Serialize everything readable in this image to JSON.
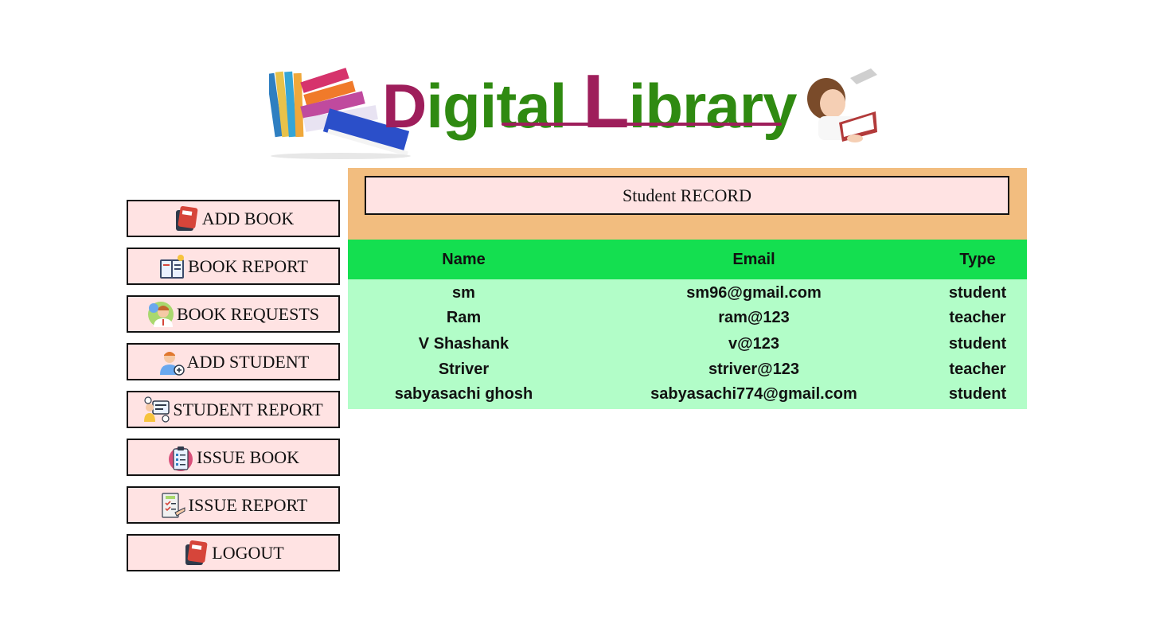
{
  "banner": {
    "word1_part1": "Digital",
    "word2_initial": "L",
    "word2_rest": "ibrary",
    "colors": {
      "magenta": "#9e1e5b",
      "green": "#2f8a11"
    }
  },
  "sidebar": {
    "items": [
      {
        "label": "ADD BOOK",
        "icon": "book-icon"
      },
      {
        "label": "BOOK REPORT",
        "icon": "book-report-icon"
      },
      {
        "label": "BOOK REQUESTS",
        "icon": "person-requests-icon"
      },
      {
        "label": "ADD STUDENT",
        "icon": "add-student-icon"
      },
      {
        "label": "STUDENT REPORT",
        "icon": "student-report-icon"
      },
      {
        "label": "ISSUE BOOK",
        "icon": "clipboard-icon"
      },
      {
        "label": "ISSUE REPORT",
        "icon": "issue-report-icon"
      },
      {
        "label": "LOGOUT",
        "icon": "book-icon"
      }
    ],
    "colors": {
      "button_bg": "#ffe3e3",
      "border": "#111111"
    }
  },
  "main": {
    "title": "Student RECORD",
    "table": {
      "columns": [
        "Name",
        "Email",
        "Type"
      ],
      "rows": [
        [
          "sm",
          "sm96@gmail.com",
          "student"
        ],
        [
          "Ram",
          "ram@123",
          "teacher"
        ],
        [
          "V Shashank",
          "v@123",
          "student"
        ],
        [
          "Striver",
          "striver@123",
          "teacher"
        ],
        [
          "sabyasachi ghosh",
          "sabyasachi774@gmail.com",
          "student"
        ]
      ]
    },
    "colors": {
      "header_panel": "#f2bd7f",
      "table_header": "#14df50",
      "table_body": "#b2fdc8"
    }
  }
}
